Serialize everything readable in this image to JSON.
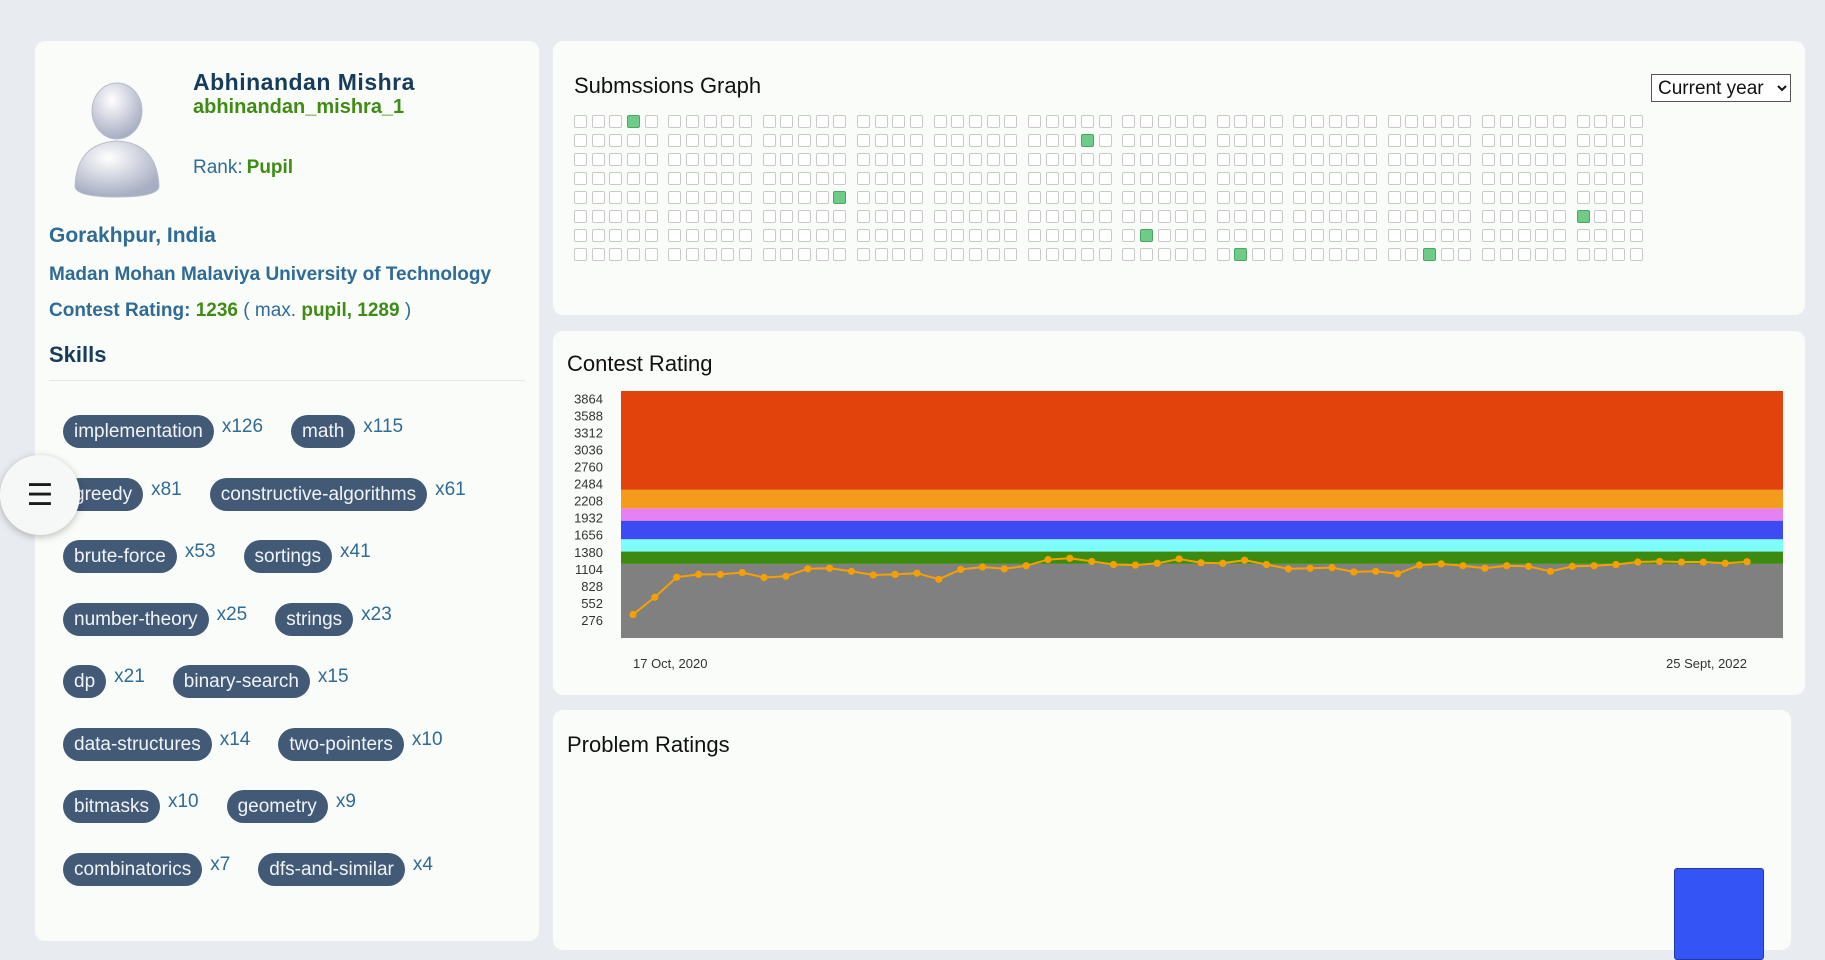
{
  "profile": {
    "name": "Abhinandan Mishra",
    "handle": "abhinandan_mishra_1",
    "rank_label": "Rank:",
    "rank": "Pupil",
    "location": "Gorakhpur, India",
    "organization": "Madan Mohan Malaviya University of Technology",
    "contest_rating_label": "Contest Rating:",
    "contest_rating": "1236",
    "max_prefix": "( max.",
    "max_rank_rating": "pupil, 1289",
    "max_suffix": ")"
  },
  "skills": {
    "title": "Skills",
    "items": [
      {
        "name": "implementation",
        "count": "x126"
      },
      {
        "name": "math",
        "count": "x115"
      },
      {
        "name": "greedy",
        "count": "x81"
      },
      {
        "name": "constructive-algorithms",
        "count": "x61"
      },
      {
        "name": "brute-force",
        "count": "x53"
      },
      {
        "name": "sortings",
        "count": "x41"
      },
      {
        "name": "number-theory",
        "count": "x25"
      },
      {
        "name": "strings",
        "count": "x23"
      },
      {
        "name": "dp",
        "count": "x21"
      },
      {
        "name": "binary-search",
        "count": "x15"
      },
      {
        "name": "data-structures",
        "count": "x14"
      },
      {
        "name": "two-pointers",
        "count": "x10"
      },
      {
        "name": "bitmasks",
        "count": "x10"
      },
      {
        "name": "geometry",
        "count": "x9"
      },
      {
        "name": "combinatorics",
        "count": "x7"
      },
      {
        "name": "dfs-and-similar",
        "count": "x4"
      }
    ]
  },
  "menu": {
    "icon": "hamburger-menu-icon",
    "glyph": "☰"
  },
  "submissions": {
    "title": "Submssions Graph",
    "period_selected": "Current year",
    "period_options": [
      "Current year"
    ]
  },
  "contest_rating_chart": {
    "title": "Contest Rating"
  },
  "problem_ratings": {
    "title": "Problem Ratings"
  },
  "chart_data": {
    "type": "line",
    "title": "Contest Rating",
    "xlabel": "",
    "ylabel": "",
    "x_start_label": "17 Oct, 2020",
    "x_end_label": "25 Sept, 2022",
    "yticks": [
      276,
      552,
      828,
      1104,
      1380,
      1656,
      1932,
      2208,
      2484,
      2760,
      3036,
      3312,
      3588,
      3864
    ],
    "ylim": [
      0,
      4000
    ],
    "grid": false,
    "bands": [
      {
        "from": 0,
        "to": 1200,
        "color": "#808080"
      },
      {
        "from": 1200,
        "to": 1400,
        "color": "#3c8a0f"
      },
      {
        "from": 1400,
        "to": 1600,
        "color": "#7ffcfc"
      },
      {
        "from": 1600,
        "to": 1900,
        "color": "#3c4bf2"
      },
      {
        "from": 1900,
        "to": 2100,
        "color": "#e780f1"
      },
      {
        "from": 2100,
        "to": 2400,
        "color": "#f39b1c"
      },
      {
        "from": 2400,
        "to": 4000,
        "color": "#e2430c"
      }
    ],
    "line_color": "#f5a000",
    "series": [
      {
        "values": [
          380,
          660,
          985,
          1030,
          1030,
          1060,
          980,
          1000,
          1120,
          1130,
          1080,
          1020,
          1030,
          1050,
          950,
          1110,
          1150,
          1120,
          1170,
          1270,
          1290,
          1240,
          1190,
          1180,
          1210,
          1280,
          1220,
          1210,
          1260,
          1190,
          1120,
          1130,
          1140,
          1070,
          1080,
          1040,
          1180,
          1200,
          1170,
          1130,
          1170,
          1160,
          1080,
          1160,
          1170,
          1190,
          1230,
          1240,
          1230,
          1230,
          1210,
          1236
        ]
      }
    ]
  }
}
